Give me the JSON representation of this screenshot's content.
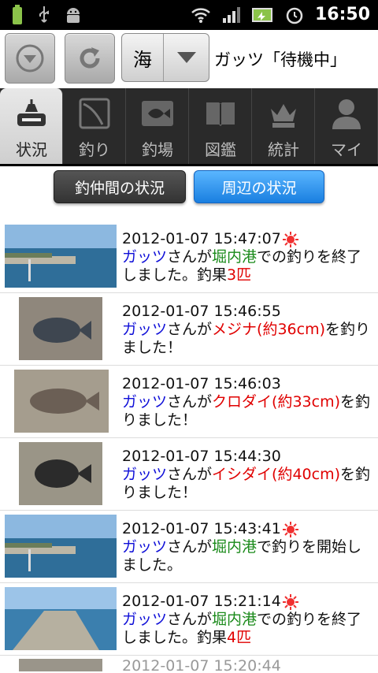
{
  "status_bar": {
    "time": "16:50",
    "left_icons": [
      "battery-low-icon",
      "usb-icon",
      "android-debug-icon"
    ],
    "right_icons": [
      "wifi-icon",
      "signal-icon",
      "charging-battery-icon",
      "alarm-clock-icon"
    ]
  },
  "toolbar": {
    "location_select_value": "海",
    "user_state": "ガッツ「待機中」"
  },
  "tabs": [
    {
      "label": "状況",
      "icon": "status-icon",
      "active": true
    },
    {
      "label": "釣り",
      "icon": "rod-icon",
      "active": false
    },
    {
      "label": "釣場",
      "icon": "map-fish-icon",
      "active": false
    },
    {
      "label": "図鑑",
      "icon": "book-icon",
      "active": false
    },
    {
      "label": "統計",
      "icon": "crown-icon",
      "active": false
    },
    {
      "label": "マイ",
      "icon": "person-icon",
      "active": false
    }
  ],
  "segments": {
    "friends": "釣仲間の状況",
    "nearby": "周辺の状況"
  },
  "feed": [
    {
      "timestamp": "2012-01-07 15:47:07",
      "name": "ガッツ",
      "p1": "さんが",
      "place": "堀内港",
      "p2": "での釣りを終了しました。釣果",
      "count": "3匹",
      "sun": true
    },
    {
      "timestamp": "2012-01-07 15:46:55",
      "name": "ガッツ",
      "p1": "さんが",
      "fish": "メジナ(約36cm)",
      "p2": "を釣りました！",
      "sun": false
    },
    {
      "timestamp": "2012-01-07 15:46:03",
      "name": "ガッツ",
      "p1": "さんが",
      "fish": "クロダイ(約33cm)",
      "p2": "を釣りました！",
      "sun": false
    },
    {
      "timestamp": "2012-01-07 15:44:30",
      "name": "ガッツ",
      "p1": "さんが",
      "fish": "イシダイ(約40cm)",
      "p2": "を釣りました！",
      "sun": false
    },
    {
      "timestamp": "2012-01-07 15:43:41",
      "name": "ガッツ",
      "p1": "さんが",
      "place": "堀内港",
      "p2": "で釣りを開始しました。",
      "sun": true
    },
    {
      "timestamp": "2012-01-07 15:21:14",
      "name": "ガッツ",
      "p1": "さんが",
      "place": "堀内港",
      "p2": "での釣りを終了しました。釣果",
      "count": "4匹",
      "sun": true
    }
  ],
  "partial_row_timestamp": "2012-01-07 15:20:44",
  "colors": {
    "name": "#1010d8",
    "place": "#1a8a1a",
    "highlight": "#e00000",
    "active_segment": "#1a7fe0"
  }
}
